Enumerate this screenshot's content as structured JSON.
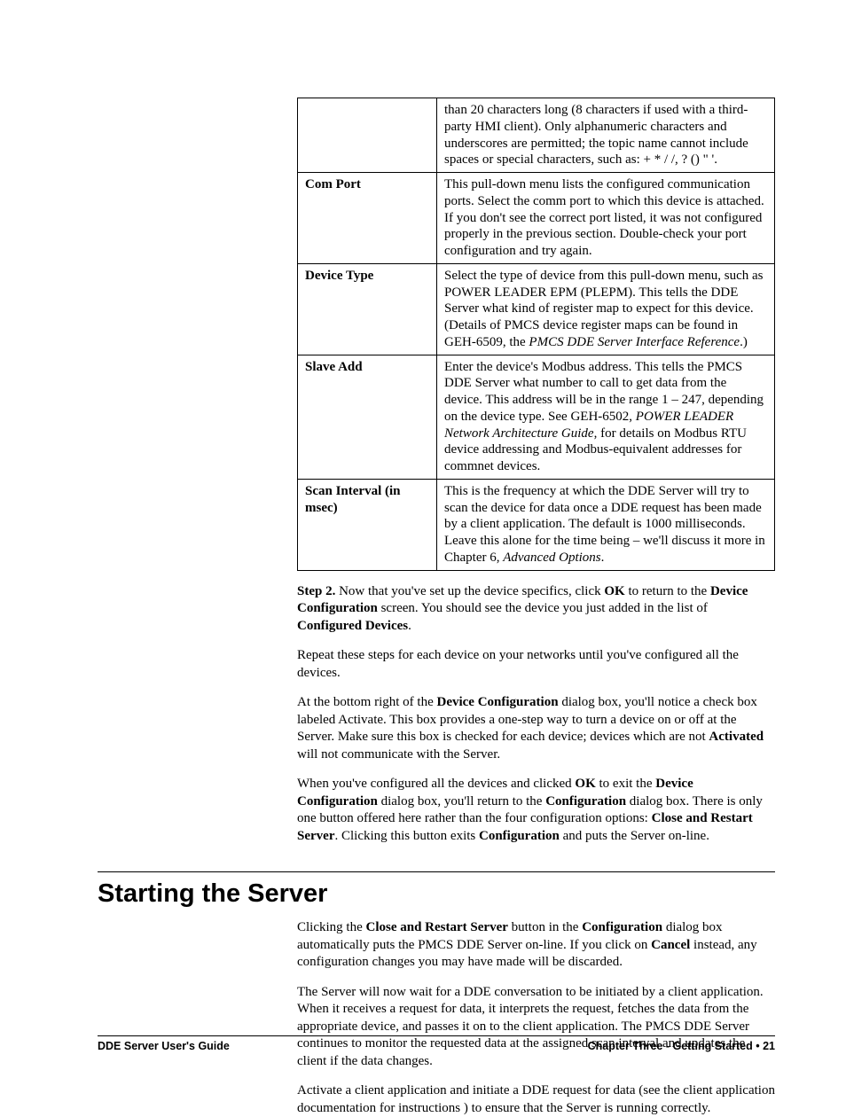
{
  "table": {
    "row0": {
      "label": "",
      "text_a": "than 20 characters long (8 characters if used with a third-party HMI client). Only alphanumeric characters and underscores are permitted; the topic name cannot include spaces or special characters, such as: + * / /, ? () \" '."
    },
    "row1": {
      "label": "Com Port",
      "text_a": "This pull-down menu lists the configured communication ports. Select the comm port to which this device is attached. If you don't see the correct port listed, it was not configured properly in the previous section. Double-check your port configuration and try again."
    },
    "row2": {
      "label": "Device Type",
      "text_a": "Select the type of device from this pull-down menu, such as POWER LEADER EPM (PLEPM). This tells the DDE Server what kind of register map to expect for this device. (Details of PMCS device register maps can be found in GEH-6509, the ",
      "italic_a": "PMCS DDE Server Interface Reference",
      "text_b": ".)"
    },
    "row3": {
      "label": "Slave Add",
      "text_a": "Enter the device's Modbus address. This tells the PMCS DDE Server what number to call to get data from the device. This address will be in the range 1 – 247, depending on the device type. See GEH-6502, ",
      "italic_a": "POWER LEADER Network Architecture Guide",
      "text_b": ", for details on Modbus RTU device addressing and Modbus-equivalent addresses for commnet devices."
    },
    "row4": {
      "label": "Scan Interval (in msec)",
      "text_a": "This is the frequency at which the DDE Server will try to scan the device for data once a DDE request has been made by a client application. The default is 1000 milliseconds. Leave this alone for the time being – we'll discuss it more in Chapter 6, ",
      "italic_a": "Advanced Options",
      "text_b": "."
    }
  },
  "p1": {
    "b1": "Step 2.",
    "t1": " Now that you've set up the device specifics, click ",
    "b2": "OK",
    "t2": " to return to the ",
    "b3": "Device Configuration",
    "t3": " screen. You should see the device you just added in the list of ",
    "b4": "Configured Devices",
    "t4": "."
  },
  "p2": {
    "t1": "Repeat these steps for each device on your networks until you've configured all the devices."
  },
  "p3": {
    "t1": "At the bottom right of the ",
    "b1": "Device Configuration",
    "t2": " dialog box, you'll notice a check box labeled Activate. This box provides a one-step way to turn a device on or off at the Server. Make sure this box is checked for each device; devices which are not ",
    "b2": "Activated",
    "t3": " will not communicate with the Server."
  },
  "p4": {
    "t1": "When you've configured all the devices and clicked ",
    "b1": "OK",
    "t2": " to exit the ",
    "b2": "Device Configuration",
    "t3": " dialog box, you'll return to the ",
    "b3": "Configuration",
    "t4": " dialog box. There is only one button offered here rather than the four configuration options: ",
    "b4": "Close and Restart Server",
    "t5": ". Clicking this button exits ",
    "b5": "Configuration",
    "t6": " and puts the Server on-line."
  },
  "heading": "Starting the Server",
  "p5": {
    "t1": "Clicking the ",
    "b1": "Close and Restart Server",
    "t2": " button in the ",
    "b2": "Configuration",
    "t3": " dialog box automatically puts the PMCS DDE Server on-line. If you click on ",
    "b3": "Cancel",
    "t4": " instead, any configuration changes you may have made will be discarded."
  },
  "p6": {
    "t1": "The Server will now wait for a DDE conversation to be initiated by a client application. When it receives a request for data, it interprets the request, fetches the data from the appropriate device, and passes it on to the client application. The PMCS DDE Server continues to monitor the requested data at the assigned scan interval and updates the client if the data changes."
  },
  "p7": {
    "t1": "Activate a client application and initiate a DDE request for data (see the client application documentation for instructions ) to ensure that the Server is running correctly."
  },
  "footer": {
    "left": "DDE Server User's Guide",
    "right_a": "Chapter Three - Getting Started",
    "bullet": "  •  ",
    "right_b": "21"
  }
}
